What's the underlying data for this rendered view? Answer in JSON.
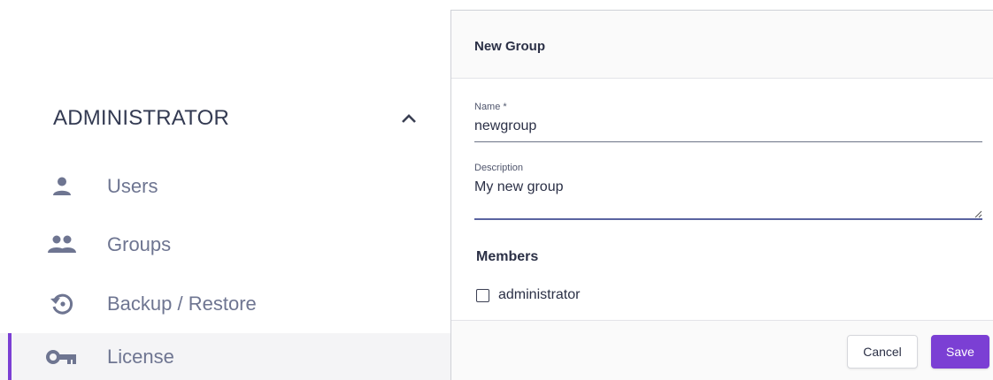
{
  "sidebar": {
    "section_title": "ADMINISTRATOR",
    "items": [
      {
        "label": "Users",
        "icon": "person-icon"
      },
      {
        "label": "Groups",
        "icon": "group-icon"
      },
      {
        "label": "Backup / Restore",
        "icon": "backup-restore-icon"
      },
      {
        "label": "License",
        "icon": "key-icon",
        "active": true
      }
    ]
  },
  "dialog": {
    "title": "New Group",
    "name_field": {
      "label": "Name *",
      "value": "newgroup"
    },
    "description_field": {
      "label": "Description",
      "value": "My new group"
    },
    "members": {
      "title": "Members",
      "items": [
        {
          "label": "administrator",
          "checked": false
        }
      ]
    },
    "cancel_label": "Cancel",
    "save_label": "Save"
  },
  "colors": {
    "accent": "#7b3fd4",
    "text_primary": "#2b3046",
    "text_muted": "#6e7591"
  }
}
